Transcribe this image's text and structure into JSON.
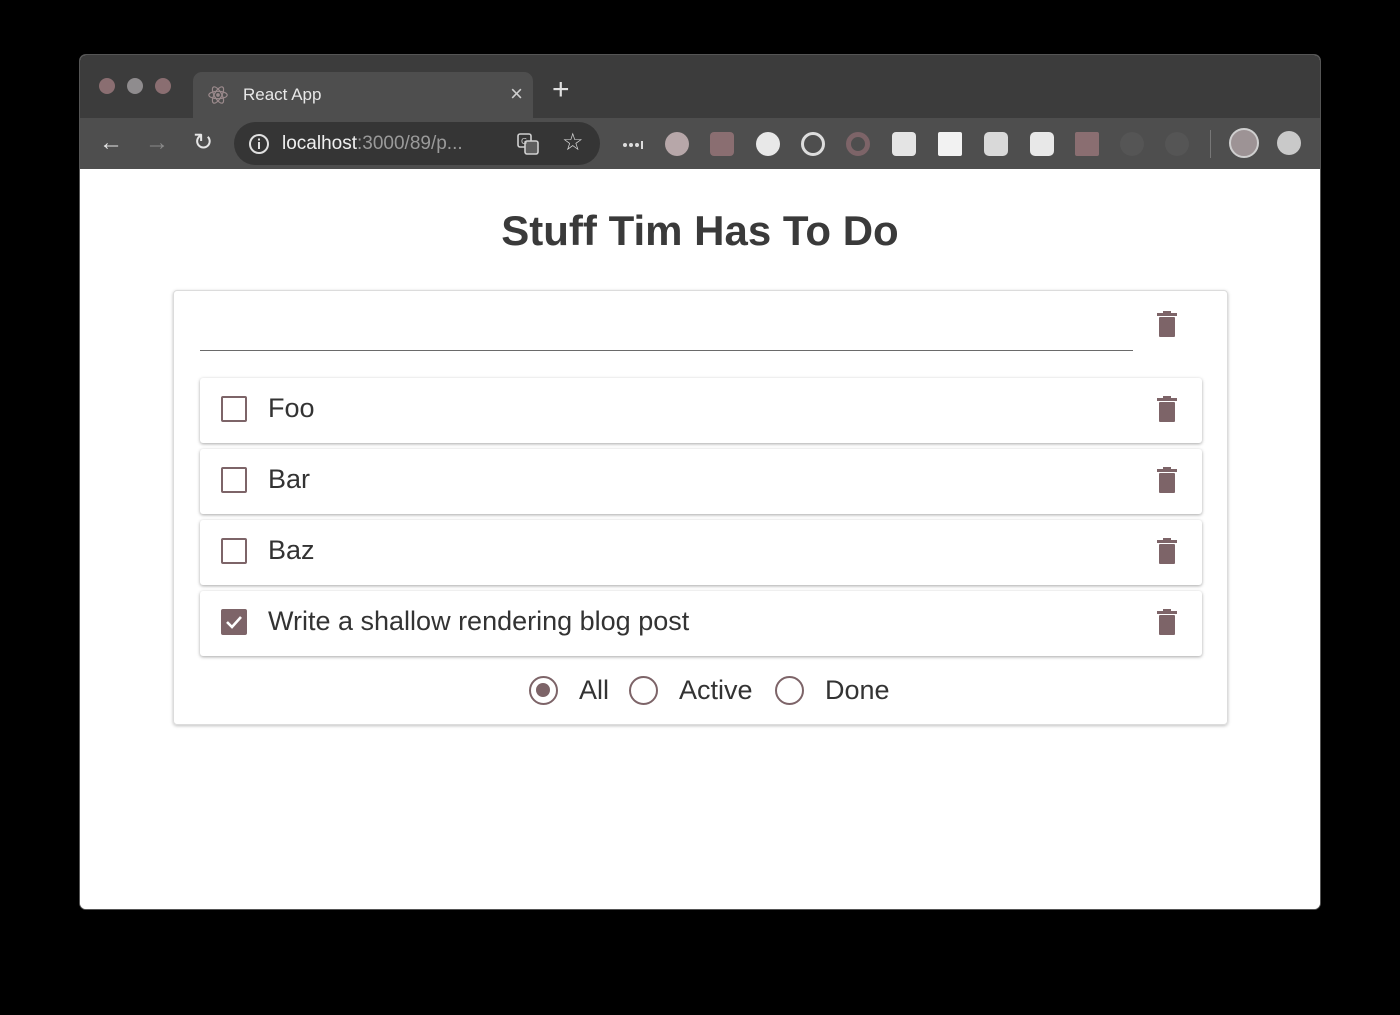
{
  "browser": {
    "tab_title": "React App",
    "tab_icon": "react-logo-icon",
    "url_host": "localhost",
    "url_rest": ":3000/89/p...",
    "extensions": [
      "menu-dots-icon",
      "hand-icon",
      "paw-icon",
      "eye-icon",
      "target-icon",
      "ring-icon",
      "grid-icon",
      "book-icon",
      "video-icon",
      "s-icon",
      "briefcase-icon",
      "hidden-icon-1",
      "hidden-icon-2"
    ]
  },
  "app": {
    "title": "Stuff Tim Has To Do",
    "new_todo_value": "",
    "todos": [
      {
        "text": "Foo",
        "done": false
      },
      {
        "text": "Bar",
        "done": false
      },
      {
        "text": "Baz",
        "done": false
      },
      {
        "text": "Write a shallow rendering blog post",
        "done": true
      }
    ],
    "filters": [
      {
        "label": "All",
        "selected": true
      },
      {
        "label": "Active",
        "selected": false
      },
      {
        "label": "Done",
        "selected": false
      }
    ],
    "accent_color": "#7d6468"
  }
}
